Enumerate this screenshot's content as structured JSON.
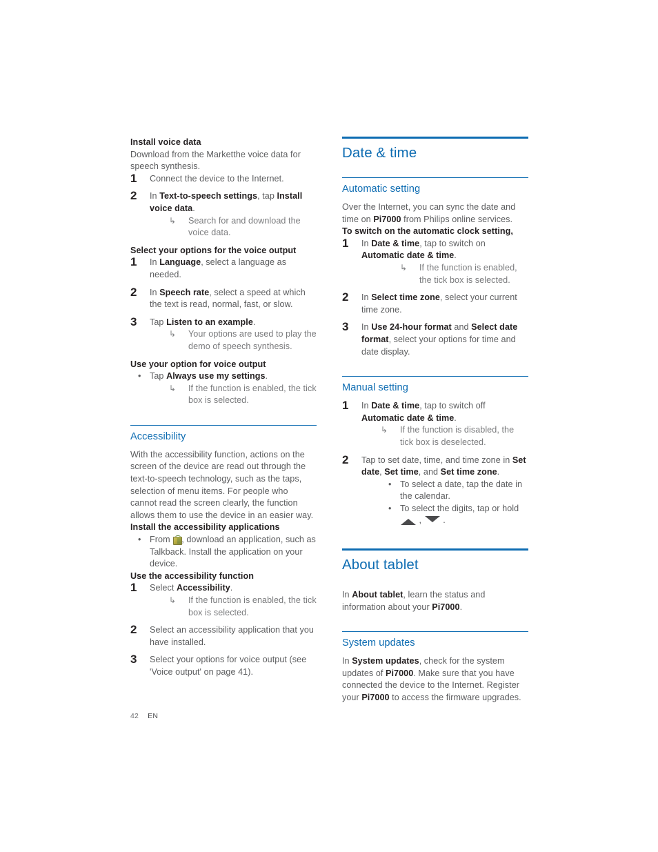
{
  "page": {
    "number": "42",
    "language": "EN",
    "accent_color": "#0d6cb2",
    "body_color": "#5b5c5e",
    "bold_color": "#262223"
  },
  "left_column": {
    "install_voice_data": {
      "subhead": "Install voice data",
      "intro": "Download from the Marketthe voice data for speech synthesis.",
      "steps": [
        {
          "text_parts": [
            {
              "t": "Connect the device to the Internet.",
              "bold": false
            }
          ]
        },
        {
          "text_parts": [
            {
              "t": "In ",
              "bold": false
            },
            {
              "t": "Text-to-speech settings",
              "bold": true
            },
            {
              "t": ", tap ",
              "bold": false
            },
            {
              "t": "Install voice data",
              "bold": true
            },
            {
              "t": ".",
              "bold": false
            }
          ],
          "result": "Search for and download the voice data."
        }
      ]
    },
    "select_options": {
      "subhead": "Select your options for the voice output",
      "steps": [
        {
          "text_parts": [
            {
              "t": "In ",
              "bold": false
            },
            {
              "t": "Language",
              "bold": true
            },
            {
              "t": ", select a language as needed.",
              "bold": false
            }
          ]
        },
        {
          "text_parts": [
            {
              "t": "In ",
              "bold": false
            },
            {
              "t": "Speech rate",
              "bold": true
            },
            {
              "t": ", select a speed at which the text is read, normal, fast, or slow.",
              "bold": false
            }
          ]
        },
        {
          "text_parts": [
            {
              "t": "Tap ",
              "bold": false
            },
            {
              "t": "Listen to an example",
              "bold": true
            },
            {
              "t": ".",
              "bold": false
            }
          ],
          "result": "Your options are used to play the demo of speech synthesis."
        }
      ]
    },
    "use_option": {
      "subhead": "Use your option for voice output",
      "bullet_parts": [
        {
          "t": "Tap ",
          "bold": false
        },
        {
          "t": "Always use my settings",
          "bold": true
        },
        {
          "t": ".",
          "bold": false
        }
      ],
      "result": "If the function is enabled, the tick box is selected."
    },
    "accessibility": {
      "heading": "Accessibility",
      "intro": "With the accessibility function, actions on the screen of the device are read out through the text-to-speech technology, such as the taps, selection of menu items. For people who cannot read the screen clearly, the function allows them to use the device in an easier way.",
      "install_subhead": "Install the accessibility applications",
      "install_bullet_pre": "From ",
      "install_bullet_post": ", download an application, such as Talkback. Install the application on your device.",
      "use_subhead": "Use the accessibility function",
      "steps": [
        {
          "text_parts": [
            {
              "t": "Select ",
              "bold": false
            },
            {
              "t": "Accessibility",
              "bold": true
            },
            {
              "t": ".",
              "bold": false
            }
          ],
          "result": "If the function is enabled, the tick box is selected."
        },
        {
          "text_parts": [
            {
              "t": "Select an accessibility application that you have installed.",
              "bold": false
            }
          ]
        },
        {
          "text_parts": [
            {
              "t": "Select your options for voice output (see 'Voice output' on page 41).",
              "bold": false
            }
          ]
        }
      ]
    }
  },
  "right_column": {
    "date_time": {
      "chapter_heading": "Date & time",
      "automatic": {
        "heading": "Automatic setting",
        "intro_parts": [
          {
            "t": "Over the Internet, you can sync the date and time on ",
            "bold": false
          },
          {
            "t": "Pi7000",
            "bold": true
          },
          {
            "t": " from Philips online services.",
            "bold": false
          }
        ],
        "subhead": "To switch on the automatic clock setting,",
        "steps": [
          {
            "text_parts": [
              {
                "t": "In ",
                "bold": false
              },
              {
                "t": "Date & time",
                "bold": true
              },
              {
                "t": ", tap to switch on ",
                "bold": false
              },
              {
                "t": "Automatic date & time",
                "bold": true
              },
              {
                "t": ".",
                "bold": false
              }
            ],
            "result": "If the function is enabled, the tick box is selected."
          },
          {
            "text_parts": [
              {
                "t": "In ",
                "bold": false
              },
              {
                "t": "Select time zone",
                "bold": true
              },
              {
                "t": ", select your current time zone.",
                "bold": false
              }
            ]
          },
          {
            "text_parts": [
              {
                "t": "In ",
                "bold": false
              },
              {
                "t": "Use 24-hour format",
                "bold": true
              },
              {
                "t": " and ",
                "bold": false
              },
              {
                "t": "Select date format",
                "bold": true
              },
              {
                "t": ", select your options for time and date display.",
                "bold": false
              }
            ]
          }
        ]
      },
      "manual": {
        "heading": "Manual setting",
        "steps": [
          {
            "text_parts": [
              {
                "t": "In ",
                "bold": false
              },
              {
                "t": "Date & time",
                "bold": true
              },
              {
                "t": ", tap to switch off ",
                "bold": false
              },
              {
                "t": "Automatic date & time",
                "bold": true
              },
              {
                "t": ".",
                "bold": false
              }
            ],
            "result": "If the function is disabled, the tick box is deselected."
          },
          {
            "text_parts": [
              {
                "t": "Tap to set date, time, and time zone in ",
                "bold": false
              },
              {
                "t": "Set date",
                "bold": true
              },
              {
                "t": ", ",
                "bold": false
              },
              {
                "t": "Set time",
                "bold": true
              },
              {
                "t": ", and ",
                "bold": false
              },
              {
                "t": "Set time zone",
                "bold": true
              },
              {
                "t": ".",
                "bold": false
              }
            ],
            "bullets": [
              {
                "text": "To select a date, tap the date in the calendar."
              },
              {
                "text_pre": "To select the digits, tap or hold ",
                "icon_up": "triangle-up-icon",
                "text_mid": " , ",
                "icon_down": "triangle-down-icon",
                "text_post": " ."
              }
            ]
          }
        ]
      }
    },
    "about_tablet": {
      "chapter_heading": "About tablet",
      "intro_parts": [
        {
          "t": "In ",
          "bold": false
        },
        {
          "t": "About tablet",
          "bold": true
        },
        {
          "t": ", learn the status and information about your ",
          "bold": false
        },
        {
          "t": "Pi7000",
          "bold": true
        },
        {
          "t": ".",
          "bold": false
        }
      ],
      "system_updates": {
        "heading": "System updates",
        "body_parts": [
          {
            "t": "In ",
            "bold": false
          },
          {
            "t": "System updates",
            "bold": true
          },
          {
            "t": ", check for the system updates of ",
            "bold": false
          },
          {
            "t": "Pi7000",
            "bold": true
          },
          {
            "t": ". Make sure that you have connected the device to the Internet. Register your ",
            "bold": false
          },
          {
            "t": "Pi7000",
            "bold": true
          },
          {
            "t": " to access the firmware upgrades.",
            "bold": false
          }
        ]
      }
    }
  },
  "glyphs": {
    "result_arrow": "↳",
    "bullet_dot": "•"
  }
}
